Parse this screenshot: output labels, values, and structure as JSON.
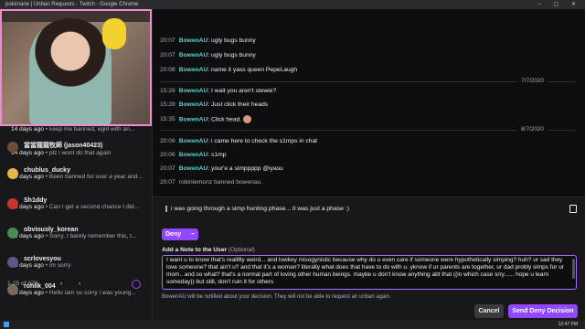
{
  "window": {
    "title": "pokimane | Unban Requests - Twitch - Google Chrome",
    "controls": "– ▢ ✕"
  },
  "sidebar": {
    "rows": [
      {
        "meta_ago": "14 days ago",
        "meta_text": "keep me banned, egirl with an..."
      },
      {
        "name": "當當龍龍牧師 (jason40423)",
        "meta_ago": "14 days ago",
        "meta_text": "plz i wont do that again"
      },
      {
        "name": "chublus_ducky",
        "meta_ago": "14 days ago",
        "meta_text": "Been banned for over a year and..."
      },
      {
        "name": "Sh1ddy",
        "meta_ago": "15 days ago",
        "meta_text": "Can I get a second chance I did..."
      },
      {
        "name": "obviously_korean",
        "meta_ago": "16 days ago",
        "meta_text": "Sorry, I barely remember this, t..."
      },
      {
        "name": "scrlovesyou",
        "meta_ago": "16 days ago",
        "meta_text": "im sorry"
      },
      {
        "name": "rohlik_004",
        "meta_ago": "16 days ago",
        "meta_text": "Hello iam so sorry i was young..."
      }
    ],
    "pager": "1-25 of 676",
    "arrows": "‹ ›"
  },
  "chat": {
    "messages": [
      {
        "time": "20:07",
        "user": "BowenAU",
        "text": ": ugly bugs bunny"
      },
      {
        "time": "20:07",
        "user": "BowenAU",
        "text": ": ugly bugs bunny"
      },
      {
        "time": "20:08",
        "user": "BowenAU",
        "text": ": name it yass queen PepeLaugh"
      },
      {
        "time": "15:28",
        "user": "BowenAU",
        "text": ": I wait you aren't stewie?"
      },
      {
        "time": "15:28",
        "user": "BowenAU",
        "text": ": Just click their heads"
      },
      {
        "time": "15:35",
        "user": "BowenAU",
        "text": ": Click head."
      },
      {
        "time": "20:06",
        "user": "BowenAU",
        "text": ": i came here to check the s1mps in chat"
      },
      {
        "time": "20:06",
        "user": "BowenAU",
        "text": ": s1mp"
      },
      {
        "time": "20:07",
        "user": "BowenAU",
        "text": ": your'e a simppppp @iyasu"
      },
      {
        "time": "20:07",
        "user": "robinlemonz",
        "text": " banned bowenau."
      }
    ],
    "dates": [
      "7/7/2020",
      "8/7/2020"
    ]
  },
  "request": {
    "text": "i was going through a simp hunting phase... it was just a phase :)"
  },
  "actions": {
    "deny_label": "Deny",
    "deny_x": "–",
    "note_label": "Add a Note to the User",
    "note_optional": "(Optional)",
    "note_text": "I want u to know that's reallllly weird... and lowkey misogynistic because why do u even care if someone were hypothetically simping? huh? ur sad they love someone? that ain't u? and that it's a woman? literally what does that have to do with u. yknow if ur parents are together, ur dad probly simps for ur mom.. and so what? that's a normal part of loving other human beings. maybe u don't know anything abt that ((in which case srry...... hope u learn someday)) but still, don't ruin it for others",
    "notice": "BowenAU will be notified about your decision. They will not be able to request an unban again.",
    "cancel": "Cancel",
    "send": "Send Deny Decision"
  },
  "taskbar": {
    "clock": "12:47 PM"
  }
}
